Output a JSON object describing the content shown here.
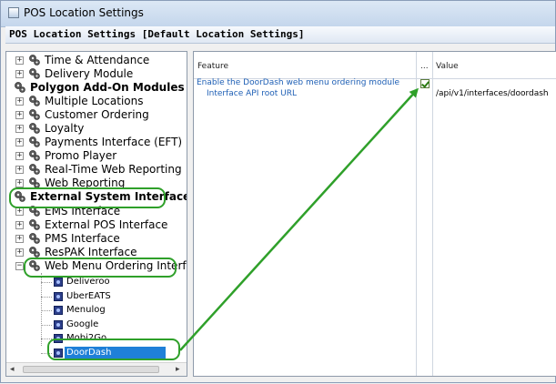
{
  "window": {
    "title": "POS Location Settings"
  },
  "header": {
    "text": "POS Location Settings  [Default Location Settings]"
  },
  "tree": {
    "items": [
      {
        "label": "Time & Attendance",
        "bold": false,
        "expander": "+"
      },
      {
        "label": "Delivery Module",
        "bold": false,
        "expander": "+"
      },
      {
        "label": "Polygon Add-On Modules",
        "bold": true,
        "expander": ""
      },
      {
        "label": "Multiple Locations",
        "bold": false,
        "expander": "+"
      },
      {
        "label": "Customer Ordering",
        "bold": false,
        "expander": "+"
      },
      {
        "label": "Loyalty",
        "bold": false,
        "expander": "+"
      },
      {
        "label": "Payments Interface (EFT)",
        "bold": false,
        "expander": "+"
      },
      {
        "label": "Promo Player",
        "bold": false,
        "expander": "+"
      },
      {
        "label": "Real-Time Web Reporting",
        "bold": false,
        "expander": "+"
      },
      {
        "label": "Web Reporting",
        "bold": false,
        "expander": "+"
      },
      {
        "label": "External System Interfaces",
        "bold": true,
        "expander": ""
      },
      {
        "label": "EMS Interface",
        "bold": false,
        "expander": "+"
      },
      {
        "label": "External POS Interface",
        "bold": false,
        "expander": "+"
      },
      {
        "label": "PMS Interface",
        "bold": false,
        "expander": "+"
      },
      {
        "label": "ResPAK Interface",
        "bold": false,
        "expander": "+"
      },
      {
        "label": "Web Menu Ordering Interfaces",
        "bold": false,
        "expander": "−"
      }
    ],
    "children": [
      {
        "label": "Deliveroo"
      },
      {
        "label": "UberEATS"
      },
      {
        "label": "Menulog"
      },
      {
        "label": "Google"
      },
      {
        "label": "Mobi2Go"
      },
      {
        "label": "DoorDash",
        "selected": true
      }
    ]
  },
  "grid": {
    "headers": {
      "feature": "Feature",
      "mid": "...",
      "value": "Value"
    },
    "rows": [
      {
        "feature": "Enable the DoorDash web menu ordering module",
        "checked": true,
        "value": ""
      },
      {
        "feature": "Interface API root URL",
        "checked": false,
        "value": "/api/v1/interfaces/doordash"
      }
    ]
  },
  "colors": {
    "annotation": "#2fa02a",
    "selection": "#1f80d8",
    "link": "#1e5fb5"
  }
}
